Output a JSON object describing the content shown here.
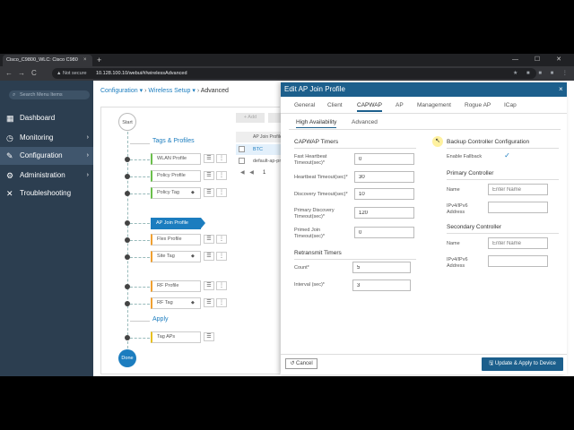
{
  "browser": {
    "tab_title": "Cisco_C9800_WLC: Cisco C980",
    "tab_close": "×",
    "new_tab": "+",
    "window_controls": "— ☐ ✕",
    "back": "←",
    "forward": "→",
    "reload": "C",
    "not_secure": "▲ Not secure",
    "url": "10.128.100.10/webui/#/wirelessAdvanced",
    "extension_icons": "★ ■ ■ ■ ⋮"
  },
  "sidebar": {
    "search_placeholder": "Search Menu Items",
    "search_icon": "⌕",
    "items": [
      {
        "label": "Dashboard",
        "icon": "▦",
        "chevron": ""
      },
      {
        "label": "Monitoring",
        "icon": "◷",
        "chevron": "›"
      },
      {
        "label": "Configuration",
        "icon": "✎",
        "chevron": "›"
      },
      {
        "label": "Administration",
        "icon": "⚙",
        "chevron": "›"
      },
      {
        "label": "Troubleshooting",
        "icon": "✕",
        "chevron": ""
      }
    ]
  },
  "breadcrumb": {
    "item1": "Configuration ▾",
    "sep1": "›",
    "item2": "Wireless Setup ▾",
    "sep2": "›",
    "current": "Advanced"
  },
  "wizard": {
    "start": "Start",
    "done": "Done",
    "section_tags": "Tags & Profiles",
    "section_apply": "Apply",
    "steps": [
      "WLAN Profile",
      "Policy Profile",
      "Policy Tag",
      "AP Join Profile",
      "Flex Profile",
      "Site Tag",
      "RF Profile",
      "RF Tag",
      "Tag APs"
    ],
    "dot_symbol": "!",
    "list_symbol": "☰",
    "tag_symbol": "◆",
    "more_symbol": "⋮"
  },
  "table": {
    "add": "+ Add",
    "header": "AP Join Profile",
    "rows": [
      "BTC",
      "default-ap-profile"
    ],
    "pager_prev": "◀ ◀",
    "pager_page": "1",
    "pager_next": "▶"
  },
  "dialog": {
    "title": "Edit AP Join Profile",
    "close": "×",
    "tabs": [
      "General",
      "Client",
      "CAPWAP",
      "AP",
      "Management",
      "Rogue AP",
      "ICap"
    ],
    "subtabs": [
      "High Availability",
      "Advanced"
    ],
    "capwap_timers": {
      "title": "CAPWAP Timers",
      "fields": [
        {
          "label": "Fast Heartbeat Timeout(sec)*",
          "value": "0"
        },
        {
          "label": "Heartbeat Timeout(sec)*",
          "value": "30"
        },
        {
          "label": "Discovery Timeout(sec)*",
          "value": "10"
        },
        {
          "label": "Primary Discovery Timeout(sec)*",
          "value": "120"
        },
        {
          "label": "Primed Join Timeout(sec)*",
          "value": "0"
        }
      ]
    },
    "retransmit_timers": {
      "title": "Retransmit Timers",
      "fields": [
        {
          "label": "Count*",
          "value": "5"
        },
        {
          "label": "Interval (sec)*",
          "value": "3"
        }
      ]
    },
    "backup": {
      "title": "Backup Controller Configuration",
      "enable_fallback_label": "Enable Fallback",
      "enable_fallback_checked": "✓",
      "primary_title": "Primary Controller",
      "secondary_title": "Secondary Controller",
      "name_label": "Name",
      "ip_label": "IPv4/IPv6 Address",
      "name_placeholder": "Enter Name"
    },
    "cursor": "↖",
    "cancel": "↺ Cancel",
    "apply": "🖫 Update & Apply to Device"
  }
}
